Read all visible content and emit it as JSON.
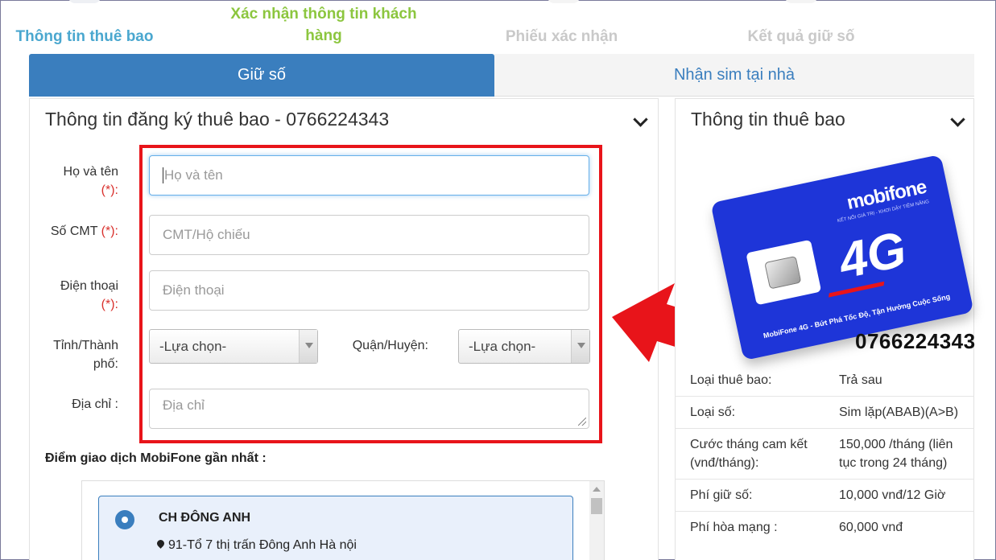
{
  "steps": [
    {
      "label": "Thông tin thuê bao",
      "state": "done"
    },
    {
      "label": "Xác nhận thông tin khách hàng",
      "state": "current"
    },
    {
      "label": "Phiếu xác nhận",
      "state": "pending"
    },
    {
      "label": "Kết quả giữ số",
      "state": "pending"
    }
  ],
  "tabs": {
    "active": "Giữ số",
    "inactive": "Nhận sim tại nhà"
  },
  "form": {
    "title": "Thông tin đăng ký thuê bao - 0766224343",
    "name_label": "Họ và tên",
    "name_req": "(*):",
    "name_placeholder": "Họ và tên",
    "id_label": "Số CMT",
    "id_req": "(*):",
    "id_placeholder": "CMT/Hộ chiếu",
    "phone_label": "Điện thoại",
    "phone_req": "(*):",
    "phone_placeholder": "Điện thoại",
    "province_label": "Tỉnh/Thành phố:",
    "province_value": "-Lựa chọn-",
    "district_label": "Quận/Huyện:",
    "district_value": "-Lựa chọn-",
    "address_label": "Địa chỉ :",
    "address_placeholder": "Địa chỉ"
  },
  "stores": {
    "heading": "Điểm giao dịch MobiFone gần nhất :",
    "items": [
      {
        "name": "CH ĐÔNG ANH",
        "address": "91-Tổ 7 thị trấn Đông Anh Hà nội"
      }
    ]
  },
  "subscriber": {
    "title": "Thông tin thuê bao",
    "card": {
      "brand": "mobifone",
      "tagline": "KẾT NỐI GIÁ TRỊ - KHƠI DẬY TIỀM NĂNG",
      "network": "4G",
      "slogan": "MobiFone 4G - Bứt Phá Tốc Độ, Tận Hưởng Cuộc Sống"
    },
    "number": "0766224343",
    "rows": [
      {
        "k": "Loại thuê bao:",
        "v": "Trả sau"
      },
      {
        "k": "Loại số:",
        "v": "Sim lặp(ABAB)(A>B)"
      },
      {
        "k": "Cước tháng cam kết (vnđ/tháng):",
        "v": "150,000 /tháng (liên tục trong 24 tháng)"
      },
      {
        "k": "Phí giữ số:",
        "v": "10,000 vnđ/12 Giờ"
      },
      {
        "k": "Phí hòa mạng :",
        "v": "60,000 vnđ"
      }
    ]
  },
  "colors": {
    "primary": "#3a7ebe",
    "step_done": "#4aa7cf",
    "step_current": "#8cc63f",
    "step_pending": "#c9c9c9",
    "highlight": "#e8141a",
    "required": "#d9302c",
    "sim_blue": "#1e35d8"
  },
  "icons": {
    "collapse": "chevron-down-icon",
    "select": "caret-down-icon",
    "location": "map-marker-icon",
    "pointer": "red-arrow-icon"
  }
}
